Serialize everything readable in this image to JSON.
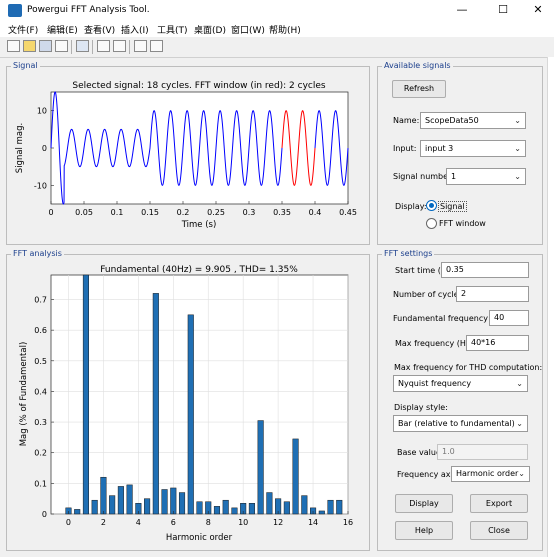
{
  "window": {
    "title": "Powergui FFT Analysis Tool.",
    "minimize": "—",
    "maximize": "☐",
    "close": "✕"
  },
  "menu": [
    "文件(F)",
    "编辑(E)",
    "查看(V)",
    "插入(I)",
    "工具(T)",
    "桌面(D)",
    "窗口(W)",
    "帮助(H)"
  ],
  "signal_panel": {
    "title": "Signal",
    "plot_title": "Selected signal: 18 cycles. FFT window (in red): 2 cycles",
    "ylabel": "Signal mag.",
    "xlabel": "Time (s)",
    "xticks": [
      "0",
      "0.05",
      "0.1",
      "0.15",
      "0.2",
      "0.25",
      "0.3",
      "0.35",
      "0.4",
      "0.45"
    ],
    "yticks": [
      "10",
      "0",
      "-10"
    ]
  },
  "available_signals": {
    "title": "Available signals",
    "refresh": "Refresh",
    "name_label": "Name:",
    "name_value": "ScopeData50",
    "input_label": "Input:",
    "input_value": "input 3",
    "signal_number_label": "Signal number:",
    "signal_number_value": "1",
    "display_label": "Display:",
    "opt_signal": "Signal",
    "opt_fft": "FFT window"
  },
  "fft_analysis": {
    "title": "FFT analysis",
    "plot_title": "Fundamental (40Hz) = 9.905 , THD= 1.35%",
    "ylabel": "Mag (% of Fundamental)",
    "xlabel": "Harmonic order",
    "xticks": [
      "0",
      "2",
      "4",
      "6",
      "8",
      "10",
      "12",
      "14",
      "16"
    ],
    "yticks": [
      "0",
      "0.1",
      "0.2",
      "0.3",
      "0.4",
      "0.5",
      "0.6",
      "0.7"
    ]
  },
  "fft_settings": {
    "title": "FFT settings",
    "start_time_label": "Start time (s):",
    "start_time_value": "0.35",
    "cycles_label": "Number of cycles:",
    "cycles_value": "2",
    "fund_freq_label": "Fundamental frequency (Hz):",
    "fund_freq_value": "40",
    "max_freq_label": "Max frequency (Hz):",
    "max_freq_value": "40*16",
    "thd_label": "Max frequency for THD computation:",
    "thd_value": "Nyquist frequency",
    "display_style_label": "Display style:",
    "display_style_value": "Bar (relative to fundamental)",
    "base_value_label": "Base value:",
    "base_value_value": "1.0",
    "freq_axis_label": "Frequency axis:",
    "freq_axis_value": "Harmonic order",
    "display_btn": "Display",
    "export_btn": "Export",
    "help_btn": "Help",
    "close_btn": "Close"
  },
  "chart_data": [
    {
      "type": "line",
      "title": "Selected signal: 18 cycles. FFT window (in red): 2 cycles",
      "xlabel": "Time (s)",
      "ylabel": "Signal mag.",
      "xlim": [
        0,
        0.45
      ],
      "ylim": [
        -15,
        15
      ],
      "frequency_hz": 40,
      "segments": [
        {
          "t_start": 0.0,
          "t_end": 0.02,
          "amplitude": 15
        },
        {
          "t_start": 0.02,
          "t_end": 0.15,
          "amplitude": 5
        },
        {
          "t_start": 0.15,
          "t_end": 0.25,
          "amplitude": 10
        },
        {
          "t_start": 0.25,
          "t_end": 0.45,
          "amplitude": 10
        }
      ],
      "fft_window": [
        0.35,
        0.4
      ],
      "colors": {
        "signal": "#0000ff",
        "window": "#ff0000"
      }
    },
    {
      "type": "bar",
      "title": "Fundamental (40Hz) = 9.905 , THD= 1.35%",
      "xlabel": "Harmonic order",
      "ylabel": "Mag (% of Fundamental)",
      "xlim": [
        -1,
        16
      ],
      "ylim": [
        0,
        0.78
      ],
      "x": [
        0,
        0.5,
        1,
        1.5,
        2,
        2.5,
        3,
        3.5,
        4,
        4.5,
        5,
        5.5,
        6,
        6.5,
        7,
        7.5,
        8,
        8.5,
        9,
        9.5,
        10,
        10.5,
        11,
        11.5,
        12,
        12.5,
        13,
        13.5,
        14,
        14.5,
        15,
        15.5
      ],
      "values": [
        0.02,
        0.015,
        0.78,
        0.045,
        0.12,
        0.06,
        0.09,
        0.095,
        0.035,
        0.05,
        0.72,
        0.08,
        0.085,
        0.07,
        0.65,
        0.04,
        0.04,
        0.025,
        0.045,
        0.02,
        0.035,
        0.035,
        0.305,
        0.07,
        0.05,
        0.04,
        0.245,
        0.06,
        0.02,
        0.01,
        0.045,
        0.045
      ],
      "color": "#1f6fb4",
      "grid": true
    }
  ]
}
